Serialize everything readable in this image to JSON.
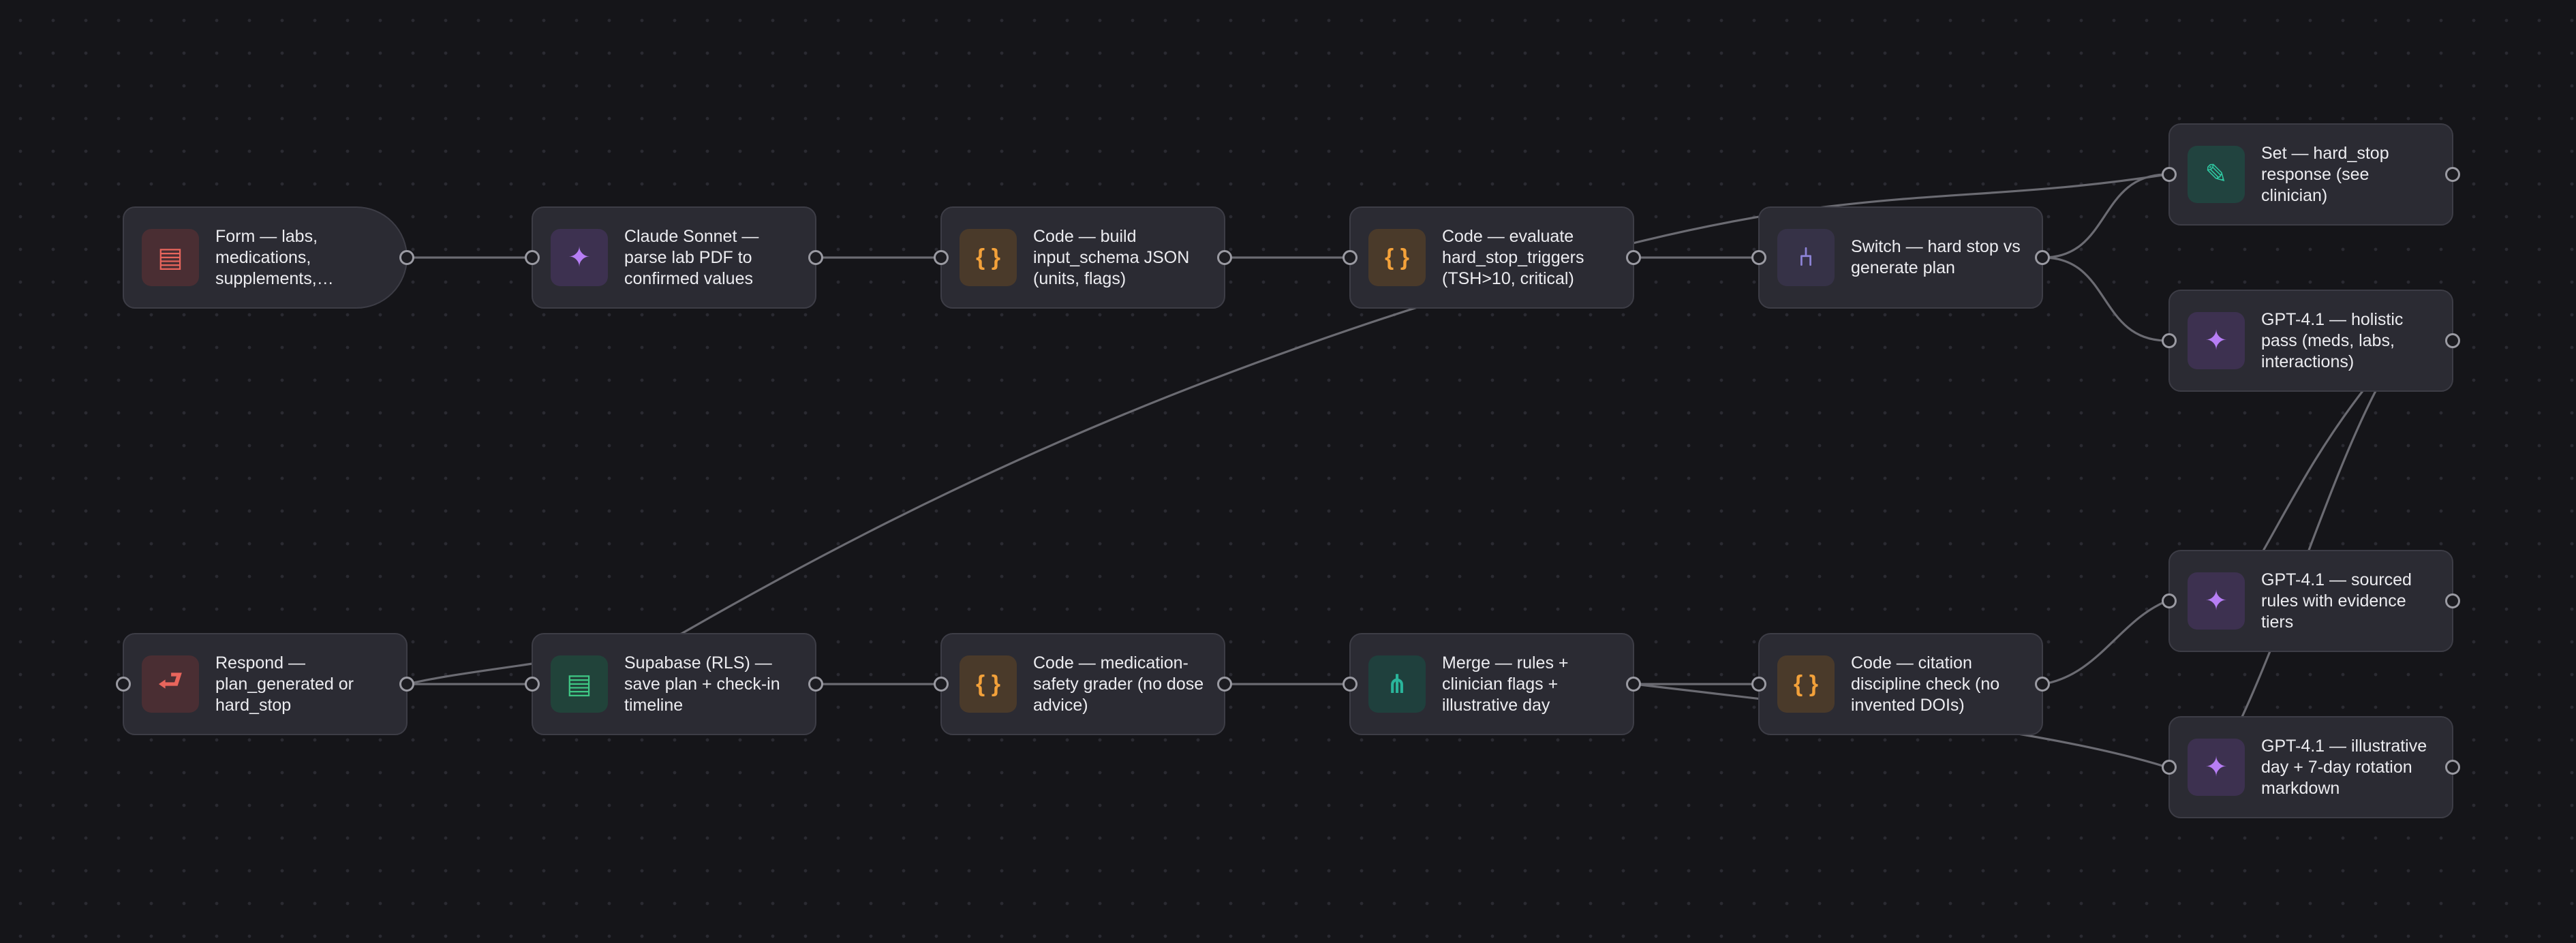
{
  "nodes": {
    "form": {
      "label": "Form — labs, medications, supplements,…",
      "icon": "form-icon"
    },
    "claude": {
      "label": "Claude Sonnet — parse lab PDF to confirmed values",
      "icon": "sparkle-icon"
    },
    "code_schema": {
      "label": "Code — build input_schema JSON (units, flags)",
      "icon": "code-braces-icon"
    },
    "code_hardstop": {
      "label": "Code — evaluate hard_stop_triggers (TSH>10, critical)",
      "icon": "code-braces-icon"
    },
    "switch": {
      "label": "Switch — hard stop vs generate plan",
      "icon": "switch-fork-icon"
    },
    "set_hardstop": {
      "label": "Set — hard_stop response (see clinician)",
      "icon": "pencil-icon"
    },
    "gpt_holistic": {
      "label": "GPT-4.1 — holistic pass (meds, labs, interactions)",
      "icon": "sparkle-icon"
    },
    "gpt_sourced": {
      "label": "GPT-4.1 — sourced rules with evidence tiers",
      "icon": "sparkle-icon"
    },
    "gpt_illustrative": {
      "label": "GPT-4.1 — illustrative day + 7-day rotation markdown",
      "icon": "sparkle-icon"
    },
    "respond": {
      "label": "Respond — plan_generated or hard_stop",
      "icon": "return-arrow-icon"
    },
    "supabase": {
      "label": "Supabase (RLS) — save plan + check-in timeline",
      "icon": "database-table-icon"
    },
    "code_grader": {
      "label": "Code — medication-safety grader (no dose advice)",
      "icon": "code-braces-icon"
    },
    "merge": {
      "label": "Merge — rules + clinician flags + illustrative day",
      "icon": "merge-icon"
    },
    "code_citation": {
      "label": "Code — citation discipline check (no invented DOIs)",
      "icon": "code-braces-icon"
    }
  },
  "icons": {
    "form": "▤",
    "sparkle": "✦",
    "code": "{ }",
    "switch": "⑃",
    "pencil": "✎",
    "respond": "⮐",
    "db": "▤",
    "merge": "⋔"
  },
  "colors": {
    "background": "#151519",
    "node_fill": "#2b2b33",
    "node_border": "#3d3d46",
    "edge": "#6b6b72",
    "accent_ai": "#b77ef5",
    "accent_code": "#f3a13a",
    "accent_form": "#e8655c",
    "accent_db": "#3fc784"
  }
}
